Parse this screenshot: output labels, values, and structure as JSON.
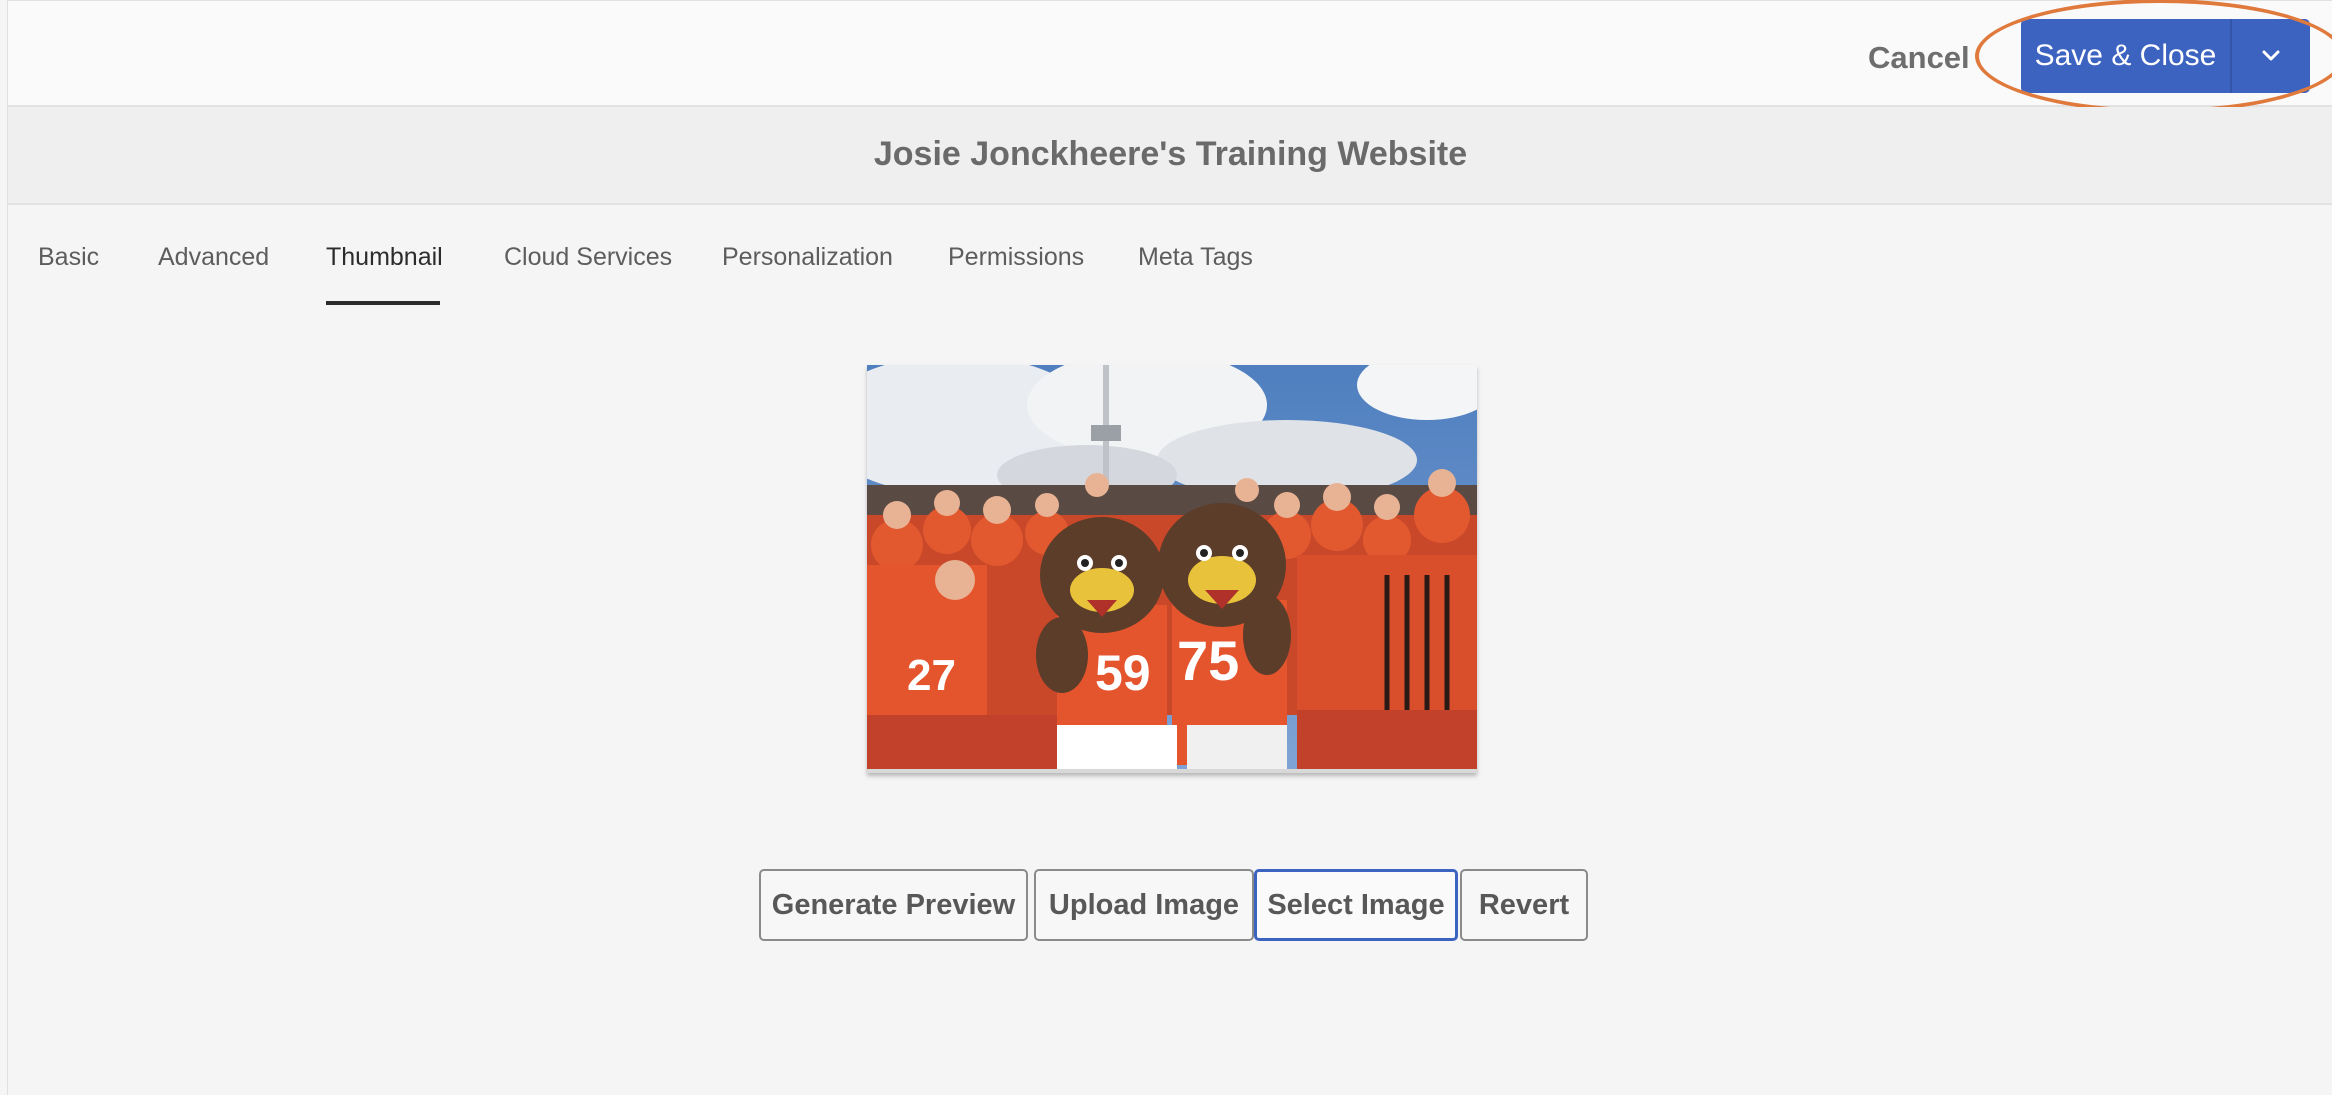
{
  "header": {
    "cancel_label": "Cancel",
    "save_label": "Save & Close",
    "save_menu_icon": "chevron-down-icon",
    "accent_color": "#3d63c0",
    "highlight_color": "#e07a3c"
  },
  "page": {
    "title": "Josie Jonckheere's Training Website"
  },
  "tabs": [
    {
      "label": "Basic",
      "active": false
    },
    {
      "label": "Advanced",
      "active": false
    },
    {
      "label": "Thumbnail",
      "active": true
    },
    {
      "label": "Cloud Services",
      "active": false
    },
    {
      "label": "Personalization",
      "active": false
    },
    {
      "label": "Permissions",
      "active": false
    },
    {
      "label": "Meta Tags",
      "active": false
    }
  ],
  "thumbnail": {
    "jersey_numbers": [
      "27",
      "59",
      "75"
    ]
  },
  "actions": {
    "generate_preview": "Generate Preview",
    "upload_image": "Upload Image",
    "select_image": "Select Image",
    "revert": "Revert"
  }
}
